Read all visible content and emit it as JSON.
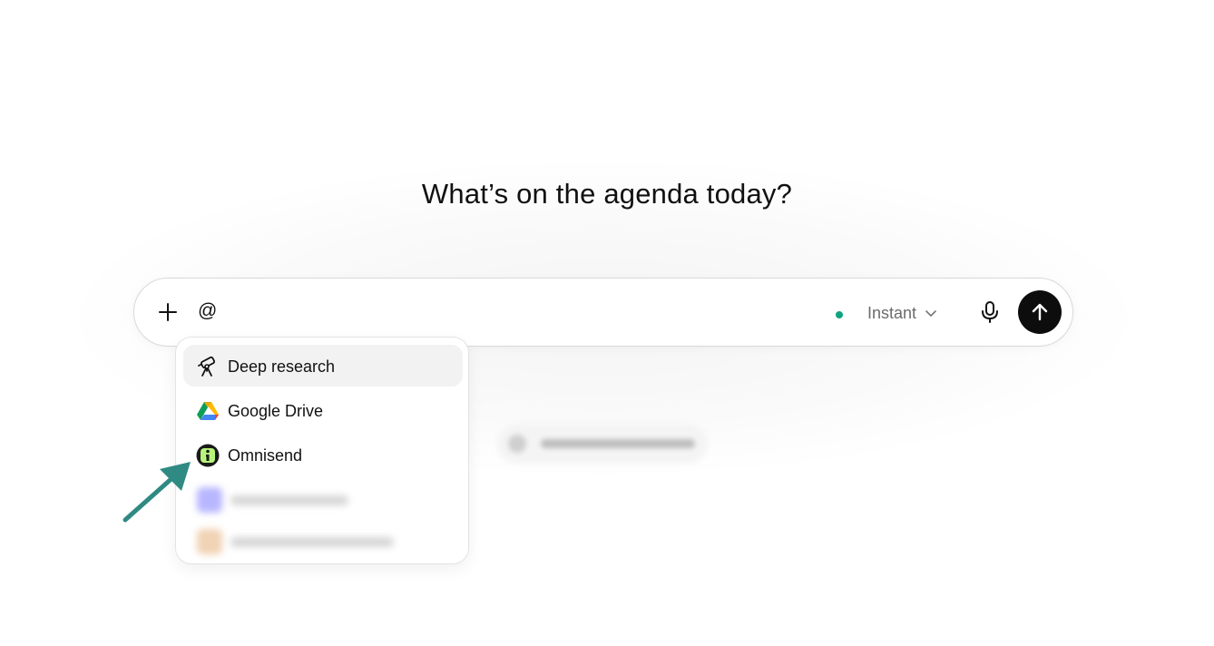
{
  "heading": "What’s on the agenda today?",
  "composer": {
    "input_value": "@",
    "model_label": "Instant",
    "icons": {
      "add": "plus-icon",
      "model_dropdown": "chevron-down-icon",
      "voice": "microphone-icon",
      "send": "arrow-up-icon"
    },
    "status_color": "#10a37f"
  },
  "mention_menu": {
    "items": [
      {
        "label": "Deep research",
        "icon": "telescope-icon",
        "highlighted": true
      },
      {
        "label": "Google Drive",
        "icon": "google-drive-icon",
        "highlighted": false
      },
      {
        "label": "Omnisend",
        "icon": "omnisend-icon",
        "highlighted": false
      }
    ],
    "blurred_items": [
      {
        "icon_color": "#b8b6ff"
      },
      {
        "icon_color": "#f0d2b4"
      }
    ]
  },
  "annotation": {
    "arrow_color": "#2e8a82",
    "points_to": "Omnisend"
  },
  "colors": {
    "send_button": "#0d0d0d",
    "menu_highlight": "#f2f2f2"
  }
}
